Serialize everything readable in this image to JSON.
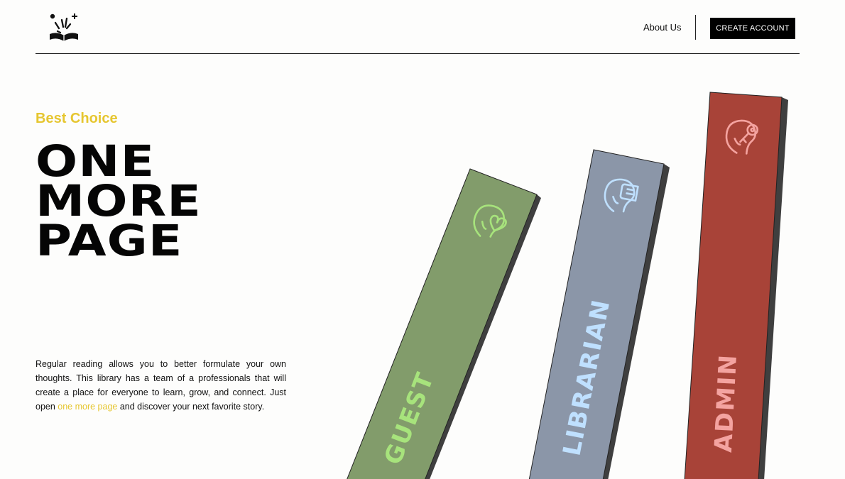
{
  "header": {
    "logo_icon": "open-book-with-sparkles-icon",
    "nav_about": "About Us",
    "create_account": "CREATE ACCOUNT"
  },
  "hero": {
    "eyebrow": "Best Choice",
    "headline": [
      "ONE",
      "MORE",
      "PAGE"
    ],
    "intro_before": "Regular reading allows you to better formulate your own thoughts. This library has a team of a professionals that will create a place for everyone to learn, grow, and connect. Just open ",
    "intro_link": "one more page",
    "intro_after": " and discover your next favorite story."
  },
  "books": [
    {
      "label": "GUEST",
      "icon": "head-heart-icon",
      "color": "#829c6b",
      "accent": "#a7e37c"
    },
    {
      "label": "LIBRARIAN",
      "icon": "head-book-icon",
      "color": "#8b96a8",
      "accent": "#bfe0ff"
    },
    {
      "label": "ADMIN",
      "icon": "head-key-icon",
      "color": "#a84338",
      "accent": "#f4a3a0"
    }
  ],
  "colors": {
    "accent_yellow": "#e6c630",
    "background": "#fdfdfc",
    "text": "#111111"
  }
}
